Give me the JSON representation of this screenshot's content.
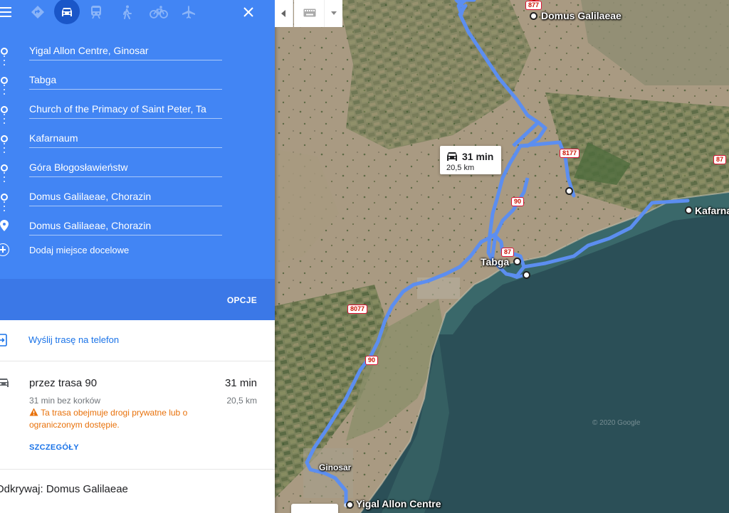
{
  "travel_modes": [
    {
      "name": "best",
      "icon": "diamond-route-icon",
      "active": false
    },
    {
      "name": "driving",
      "icon": "car-icon",
      "active": true
    },
    {
      "name": "transit",
      "icon": "train-icon",
      "active": false
    },
    {
      "name": "walking",
      "icon": "walk-icon",
      "active": false
    },
    {
      "name": "cycling",
      "icon": "bike-icon",
      "active": false
    },
    {
      "name": "flights",
      "icon": "plane-icon",
      "active": false
    }
  ],
  "waypoints": [
    "Yigal Allon Centre, Ginosar",
    "Tabga",
    "Church of the Primacy of Saint Peter, Ta",
    "Kafarnaum",
    "Góra Błogosławieństw",
    "Domus Galilaeae, Chorazin",
    "Domus Galilaeae, Chorazin"
  ],
  "add_destination": "Dodaj miejsce docelowe",
  "options_label": "OPCJE",
  "send_to_phone": "Wyślij trasę na telefon",
  "route": {
    "title": "przez trasa 90",
    "duration": "31 min",
    "subtitle": "31 min bez korków",
    "distance": "20,5 km",
    "warning": "Ta trasa obejmuje drogi prywatne lub o ograniczonym dostępie.",
    "details": "SZCZEGÓŁY"
  },
  "explore": "Odkrywaj: Domus Galilaeae",
  "map": {
    "tooltip_time": "31 min",
    "tooltip_dist": "20,5 km",
    "labels": {
      "domus": "Domus Galilaeae",
      "tabga": "Tabga",
      "kafarnaum": "Kafarna",
      "ginosar": "Ginosar",
      "yigal": "Yigal Allon Centre"
    },
    "roads": {
      "r877_top": "877",
      "r8177": "8177",
      "r90_a": "90",
      "r87": "87",
      "r8077": "8077",
      "r90_b": "90",
      "r87_right": "87"
    },
    "copyright": "© 2020 Google"
  },
  "colors": {
    "panel_blue": "#4285f4",
    "options_blue": "#3b78e7",
    "route_blue": "#5c8ef0",
    "link_blue": "#1a73e8",
    "warning_orange": "#e8710a"
  }
}
